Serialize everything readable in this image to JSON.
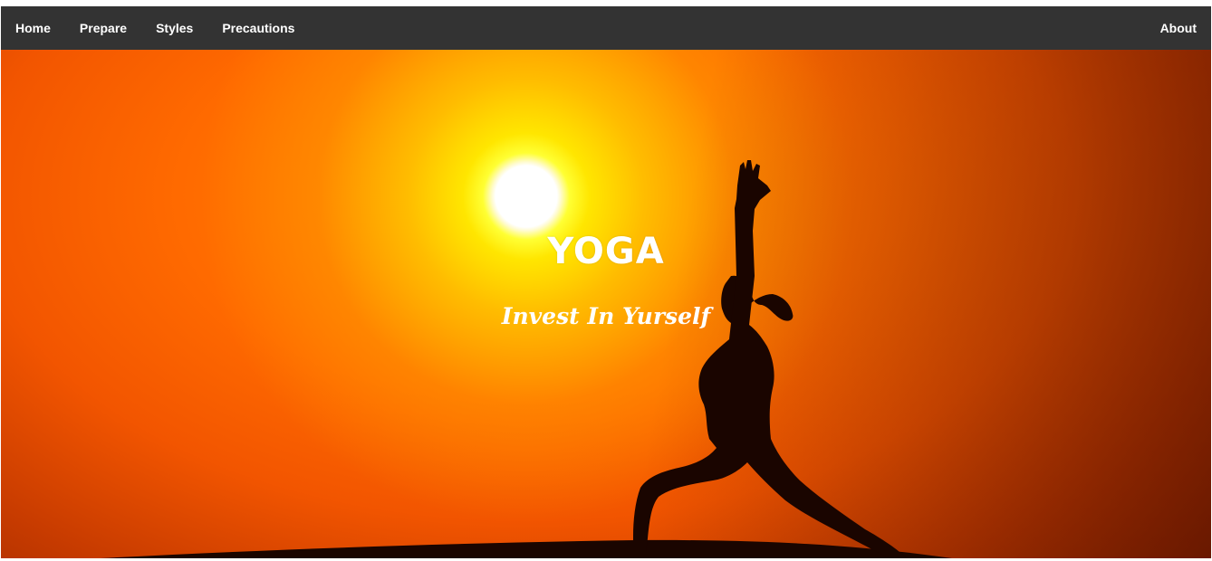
{
  "nav": {
    "home": "Home",
    "prepare": "Prepare",
    "styles": "Styles",
    "precautions": "Precautions",
    "about": "About"
  },
  "hero": {
    "title": "YOGA",
    "subtitle": "Invest In Yurself"
  },
  "colors": {
    "navbar": "#333333",
    "nav_text": "#ffffff",
    "sky_orange": "#ff6a00",
    "sun_yellow": "#ffff33",
    "silhouette": "#1a0500"
  },
  "icons": {
    "hero_figure": "yoga-warrior-pose-silhouette",
    "sun": "sun"
  }
}
